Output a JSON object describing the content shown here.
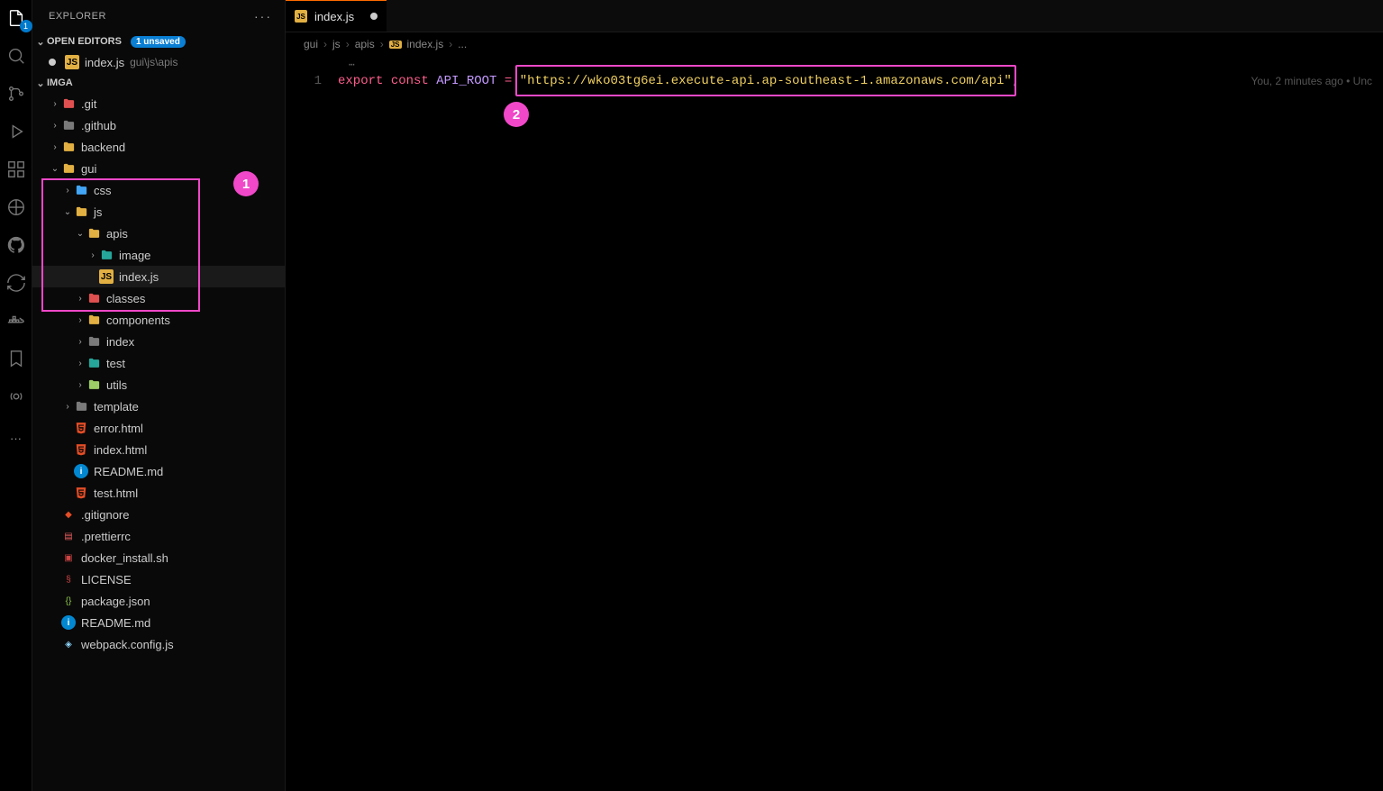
{
  "activityBar": {
    "badge": "1"
  },
  "explorer": {
    "title": "EXPLORER",
    "openEditors": {
      "label": "OPEN EDITORS",
      "unsavedBadge": "1 unsaved",
      "items": [
        {
          "filename": "index.js",
          "pathHint": "gui\\js\\apis",
          "modified": true
        }
      ]
    },
    "workspace": {
      "name": "IMGA",
      "tree": [
        {
          "depth": 1,
          "type": "folder",
          "name": ".git",
          "expanded": false,
          "color": "red"
        },
        {
          "depth": 1,
          "type": "folder",
          "name": ".github",
          "expanded": false,
          "color": "gray"
        },
        {
          "depth": 1,
          "type": "folder",
          "name": "backend",
          "expanded": false,
          "color": "yellow"
        },
        {
          "depth": 1,
          "type": "folder",
          "name": "gui",
          "expanded": true,
          "color": "yellow"
        },
        {
          "depth": 2,
          "type": "folder",
          "name": "css",
          "expanded": false,
          "color": "blue"
        },
        {
          "depth": 2,
          "type": "folder",
          "name": "js",
          "expanded": true,
          "color": "yellow"
        },
        {
          "depth": 3,
          "type": "folder",
          "name": "apis",
          "expanded": true,
          "color": "yellow"
        },
        {
          "depth": 4,
          "type": "folder",
          "name": "image",
          "expanded": false,
          "color": "teal"
        },
        {
          "depth": 4,
          "type": "file",
          "name": "index.js",
          "icon": "js",
          "selected": true
        },
        {
          "depth": 3,
          "type": "folder",
          "name": "classes",
          "expanded": false,
          "color": "red"
        },
        {
          "depth": 3,
          "type": "folder",
          "name": "components",
          "expanded": false,
          "color": "yellow"
        },
        {
          "depth": 3,
          "type": "folder",
          "name": "index",
          "expanded": false,
          "color": "gray"
        },
        {
          "depth": 3,
          "type": "folder",
          "name": "test",
          "expanded": false,
          "color": "teal"
        },
        {
          "depth": 3,
          "type": "folder",
          "name": "utils",
          "expanded": false,
          "color": "lime"
        },
        {
          "depth": 2,
          "type": "folder",
          "name": "template",
          "expanded": false,
          "color": "gray"
        },
        {
          "depth": 2,
          "type": "file",
          "name": "error.html",
          "icon": "html"
        },
        {
          "depth": 2,
          "type": "file",
          "name": "index.html",
          "icon": "html"
        },
        {
          "depth": 2,
          "type": "file",
          "name": "README.md",
          "icon": "info"
        },
        {
          "depth": 2,
          "type": "file",
          "name": "test.html",
          "icon": "html"
        },
        {
          "depth": 1,
          "type": "file",
          "name": ".gitignore",
          "icon": "git"
        },
        {
          "depth": 1,
          "type": "file",
          "name": ".prettierrc",
          "icon": "prettier"
        },
        {
          "depth": 1,
          "type": "file",
          "name": "docker_install.sh",
          "icon": "sh"
        },
        {
          "depth": 1,
          "type": "file",
          "name": "LICENSE",
          "icon": "license"
        },
        {
          "depth": 1,
          "type": "file",
          "name": "package.json",
          "icon": "json"
        },
        {
          "depth": 1,
          "type": "file",
          "name": "README.md",
          "icon": "info"
        },
        {
          "depth": 1,
          "type": "file",
          "name": "webpack.config.js",
          "icon": "webpack"
        }
      ]
    }
  },
  "tab": {
    "filename": "index.js"
  },
  "breadcrumbs": {
    "parts": [
      "gui",
      "js",
      "apis"
    ],
    "file": "index.js",
    "tail": "..."
  },
  "code": {
    "lineNumber": "1",
    "line1": {
      "kw1": "export",
      "kw2": "const",
      "ident": "API_ROOT",
      "eq": "=",
      "str": "\"https://wko03tg6ei.execute-api.ap-southeast-1.amazonaws.com/api\"",
      "end": ";"
    }
  },
  "gitlens": "You, 2 minutes ago • Unc",
  "annotations": {
    "callout1": "1",
    "callout2": "2"
  }
}
